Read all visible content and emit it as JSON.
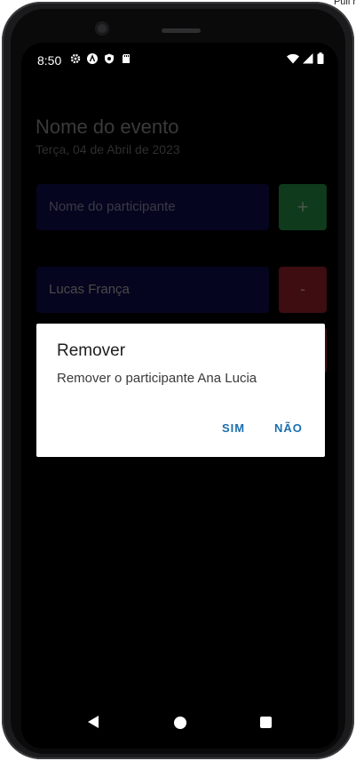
{
  "corner": {
    "text": "Pull r"
  },
  "status_bar": {
    "time": "8:50",
    "left_icons": [
      "gear-icon",
      "a-icon",
      "shield-icon",
      "sd-card-icon"
    ],
    "right_icons": [
      "wifi-icon",
      "signal-icon",
      "battery-icon"
    ]
  },
  "event": {
    "title": "Nome do evento",
    "date": "Terça, 04 de Abril de 2023"
  },
  "form": {
    "participant_placeholder": "Nome do participante",
    "add_label": "+"
  },
  "participants": [
    {
      "name": "Lucas França",
      "remove_label": "-"
    }
  ],
  "dialog": {
    "title": "Remover",
    "message": "Remover o participante Ana Lucia",
    "confirm_label": "SIM",
    "cancel_label": "NÃO"
  },
  "colors": {
    "accent": "#1a6fae",
    "add_button": "#0f3a1b",
    "remove_button": "#3d0d11",
    "input_bg": "#05051f"
  }
}
